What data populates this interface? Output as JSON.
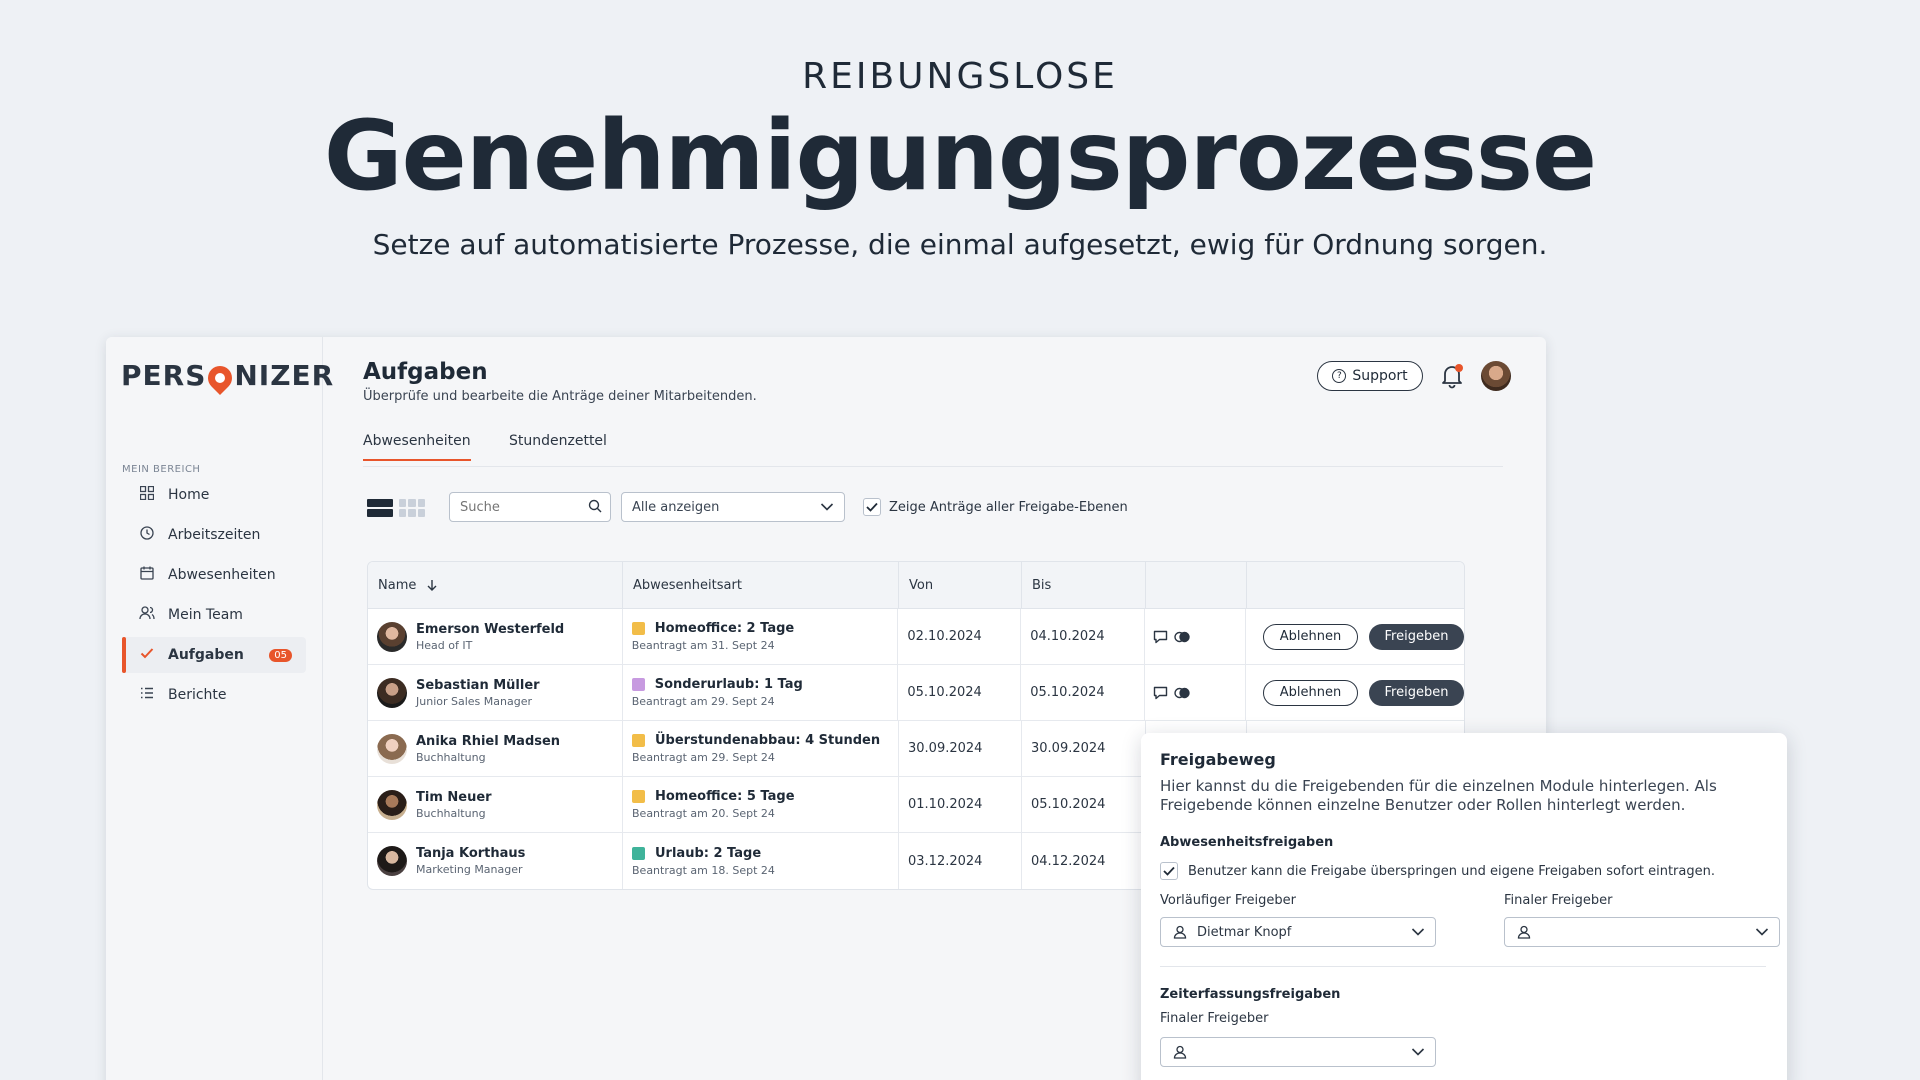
{
  "hero": {
    "eyebrow": "REIBUNGSLOSE",
    "title": "Genehmigungsprozesse",
    "subtitle": "Setze auf automatisierte Prozesse, die einmal aufgesetzt, ewig für Ordnung sorgen."
  },
  "brand": {
    "logo_left": "PERS",
    "logo_right": "NIZER",
    "accent": "#e8552b"
  },
  "sidebar": {
    "section": "MEIN BEREICH",
    "items": [
      {
        "label": "Home",
        "icon": "grid-icon"
      },
      {
        "label": "Arbeitszeiten",
        "icon": "clock-icon"
      },
      {
        "label": "Abwesenheiten",
        "icon": "calendar-icon"
      },
      {
        "label": "Mein Team",
        "icon": "team-icon"
      },
      {
        "label": "Aufgaben",
        "icon": "check-icon",
        "badge": "05",
        "active": true
      },
      {
        "label": "Berichte",
        "icon": "list-icon"
      }
    ]
  },
  "header": {
    "title": "Aufgaben",
    "subtitle": "Überprüfe und bearbeite die Anträge deiner Mitarbeitenden.",
    "support_label": "Support"
  },
  "tabs": [
    {
      "label": "Abwesenheiten",
      "active": true
    },
    {
      "label": "Stundenzettel",
      "active": false
    }
  ],
  "toolbar": {
    "search_placeholder": "Suche",
    "filter_value": "Alle anzeigen",
    "checkbox_label": "Zeige Anträge aller Freigabe-Ebenen",
    "checkbox_checked": true
  },
  "table": {
    "columns": [
      "Name",
      "Abwesenheitsart",
      "Von",
      "Bis"
    ],
    "reject_label": "Ablehnen",
    "approve_label": "Freigeben",
    "rows": [
      {
        "name": "Emerson Westerfeld",
        "role": "Head of IT",
        "type": "Homeoffice: 2 Tage",
        "requested": "Beantragt am 31. Sept 24",
        "color": "#f2bd48",
        "from": "02.10.2024",
        "to": "04.10.2024"
      },
      {
        "name": "Sebastian Müller",
        "role": "Junior Sales Manager",
        "type": "Sonderurlaub: 1 Tag",
        "requested": "Beantragt am 29. Sept 24",
        "color": "#c79ae0",
        "from": "05.10.2024",
        "to": "05.10.2024"
      },
      {
        "name": "Anika Rhiel Madsen",
        "role": "Buchhaltung",
        "type": "Überstundenabbau: 4 Stunden",
        "requested": "Beantragt am 29. Sept 24",
        "color": "#f2bd48",
        "from": "30.09.2024",
        "to": "30.09.2024"
      },
      {
        "name": "Tim Neuer",
        "role": "Buchhaltung",
        "type": "Homeoffice: 5 Tage",
        "requested": "Beantragt am 20. Sept 24",
        "color": "#f2bd48",
        "from": "01.10.2024",
        "to": "05.10.2024"
      },
      {
        "name": "Tanja Korthaus",
        "role": "Marketing Manager",
        "type": "Urlaub: 2 Tage",
        "requested": "Beantragt am 18. Sept 24",
        "color": "#3fb39a",
        "from": "03.12.2024",
        "to": "04.12.2024"
      }
    ]
  },
  "popup": {
    "title": "Freigabeweg",
    "description": "Hier kannst du die Freigebenden für die einzelnen Module hinterlegen. Als Freigebende können einzelne Benutzer oder Rollen hinterlegt werden.",
    "absence_heading": "Abwesenheitsfreigaben",
    "skip_label": "Benutzer kann die Freigabe überspringen und eigene Freigaben sofort eintragen.",
    "prelim_label": "Vorläufiger Freigeber",
    "prelim_value": "Dietmar Knopf",
    "final_label": "Finaler Freigeber",
    "final_value": "",
    "time_heading": "Zeiterfassungsfreigaben",
    "time_final_label": "Finaler Freigeber",
    "time_final_value": ""
  }
}
